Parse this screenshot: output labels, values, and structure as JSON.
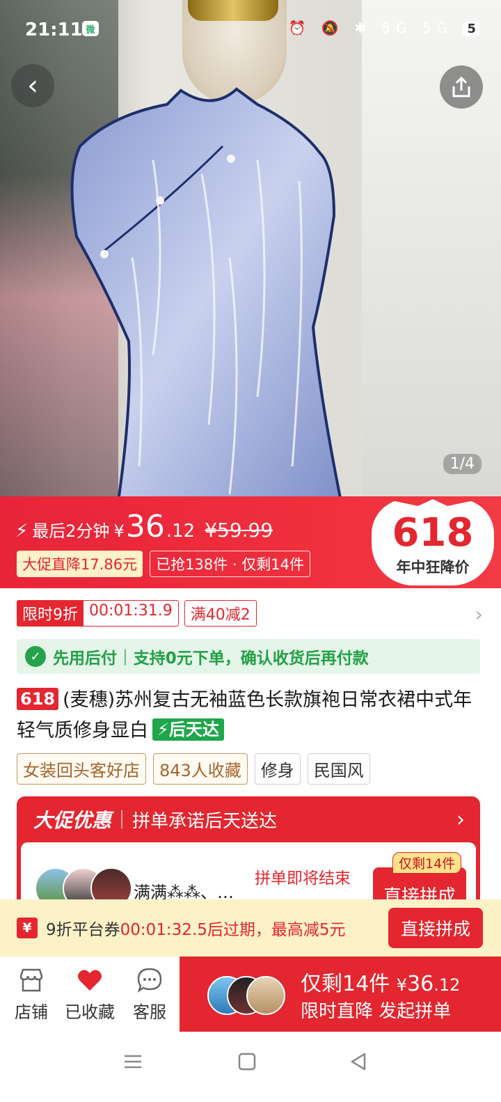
{
  "status_bar": {
    "time": "21:11",
    "wechat_icon": "wechat-icon",
    "signals": "⏰ 🔕 ✱ 5G 5G",
    "battery": "5"
  },
  "hero": {
    "counter": "1/4"
  },
  "price_banner": {
    "flash_label": "最后2分钟",
    "yen": "¥",
    "price_int": "36",
    "price_dec": ".12",
    "original_price": "¥59.99",
    "discount_tag": "大促直降17.86元",
    "sold_tag": "已抢138件 · 仅剩14件",
    "badge_number": "618",
    "badge_text": "年中狂降价"
  },
  "promo": {
    "limited_discount": "限时9折",
    "countdown": "00:01:31.9",
    "threshold": "满40减2"
  },
  "pay_later": {
    "label": "先用后付",
    "text": "支持0元下单，确认收货后再付款"
  },
  "product": {
    "tag": "618",
    "title": "(麦穗)苏州复古无袖蓝色长款旗袍日常衣裙中式年轻气质修身显白",
    "delivery_tag": "后天达"
  },
  "shop_tags": [
    "女装回头客好店",
    "843人收藏",
    "修身",
    "民国风"
  ],
  "group_card": {
    "logo": "大促优惠",
    "subtitle": "拼单承诺后天送达",
    "names": "满满⁂⁂、…",
    "ending": "拼单即将结束",
    "remaining_tag": "仅剩14件",
    "button": "直接拼成"
  },
  "coupon": {
    "icon": "¥",
    "text_prefix": "9折平台券",
    "text_time": "00:01:32.5后过期，最高减5元",
    "button": "直接拼成"
  },
  "bottom_bar": {
    "shop": "店铺",
    "favorited": "已收藏",
    "service": "客服",
    "remaining": "仅剩14件",
    "yen": "¥",
    "price": "36",
    "price_dec": ".12",
    "action": "限时直降 发起拼单"
  },
  "colors": {
    "brand_red": "#e3262f",
    "green": "#22a046",
    "coupon_bg": "#fdf1c8"
  }
}
